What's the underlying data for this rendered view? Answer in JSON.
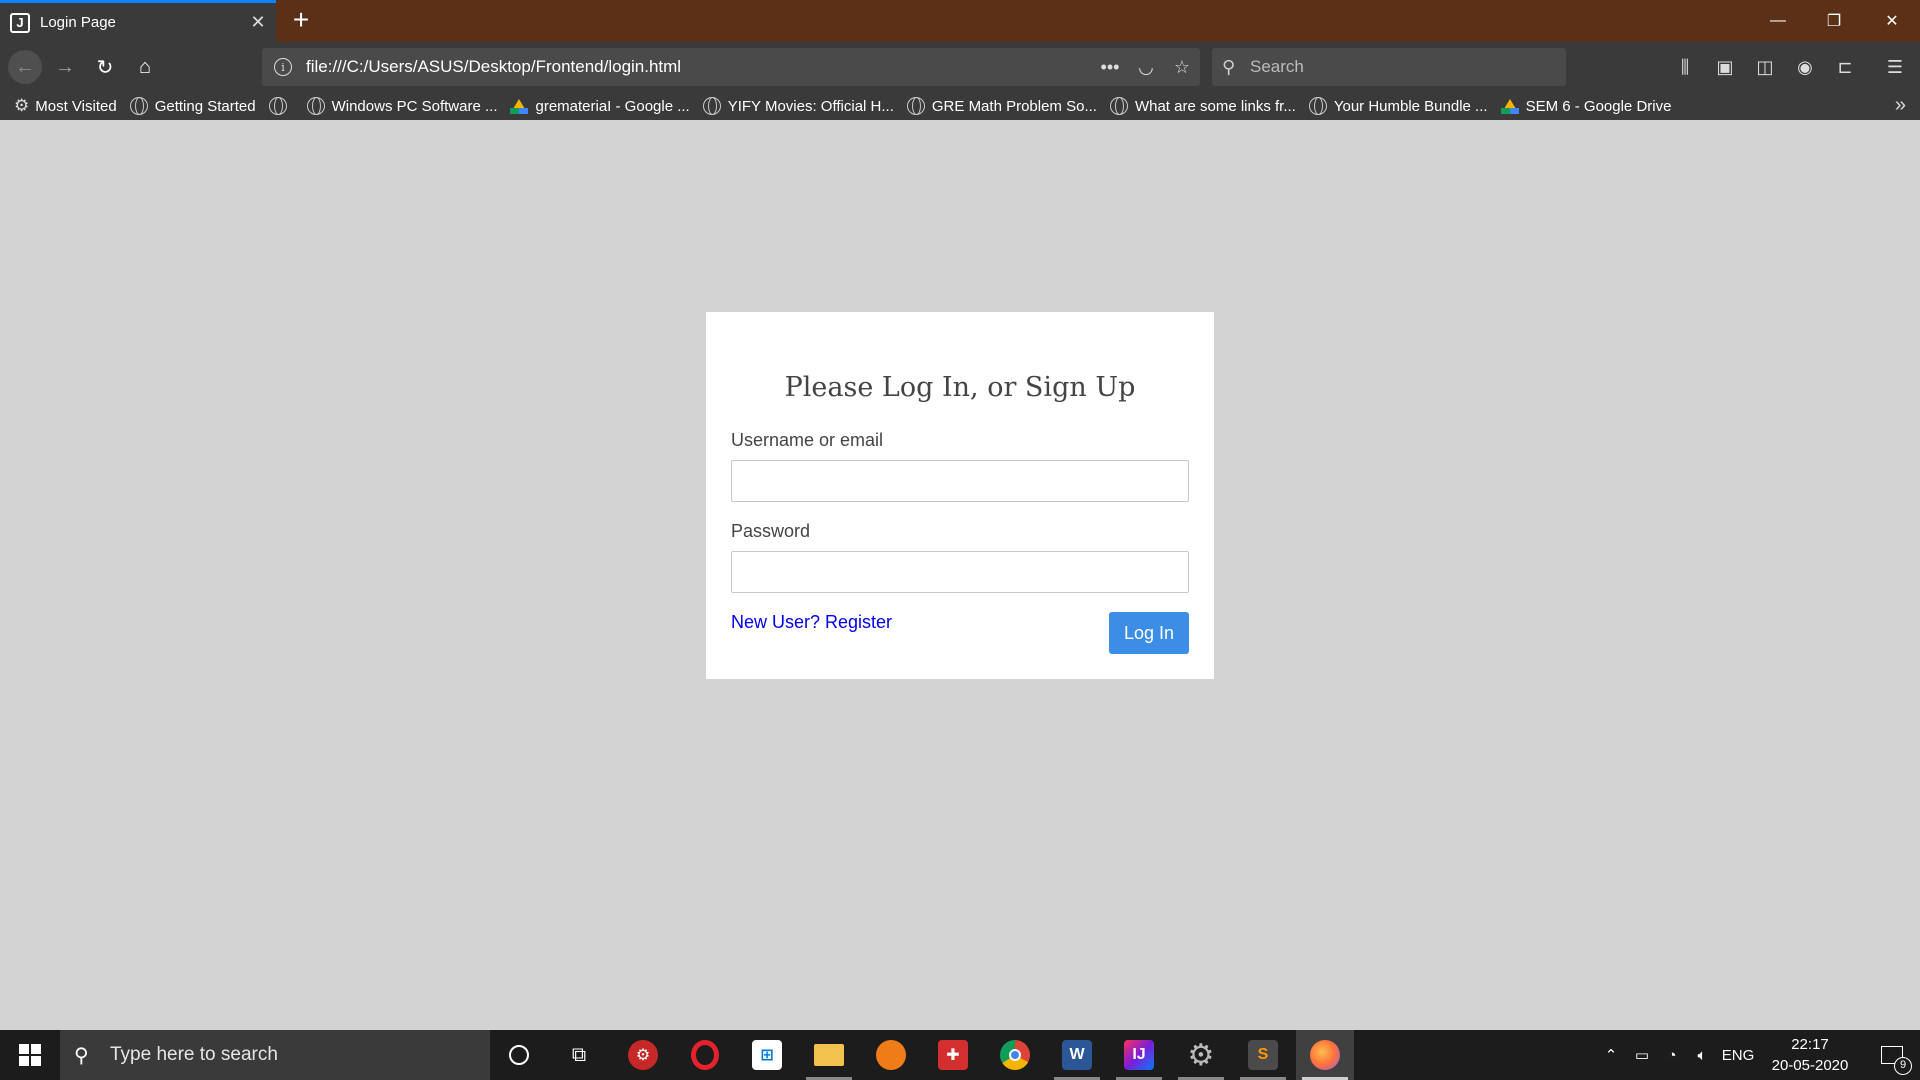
{
  "browser": {
    "tab": {
      "title": "Login Page",
      "favicon_letter": "J"
    },
    "url": "file:///C:/Users/ASUS/Desktop/Frontend/login.html",
    "search_placeholder": "Search",
    "bookmarks": [
      {
        "label": "Most Visited",
        "icon": "gear-icon"
      },
      {
        "label": "Getting Started",
        "icon": "globe-icon"
      },
      {
        "label": "",
        "icon": "globe-icon"
      },
      {
        "label": "Windows PC Software ...",
        "icon": "globe-icon"
      },
      {
        "label": "gremateriaI - Google ...",
        "icon": "google-drive-icon"
      },
      {
        "label": "YIFY Movies: Official H...",
        "icon": "globe-icon"
      },
      {
        "label": "GRE Math Problem So...",
        "icon": "globe-icon"
      },
      {
        "label": "What are some links fr...",
        "icon": "globe-icon"
      },
      {
        "label": "Your Humble Bundle ...",
        "icon": "globe-icon"
      },
      {
        "label": "SEM 6 - Google Drive",
        "icon": "google-drive-icon"
      }
    ]
  },
  "login": {
    "title": "Please Log In, or Sign Up",
    "username_label": "Username or email",
    "username_value": "",
    "password_label": "Password",
    "password_value": "",
    "register_link": "New User? Register",
    "login_button": "Log In"
  },
  "taskbar": {
    "search_placeholder": "Type here to search",
    "language": "ENG",
    "time": "22:17",
    "date": "20-05-2020",
    "notification_count": "9"
  },
  "colors": {
    "page_background": "#d3d3d3",
    "login_button": "#3b8de5",
    "link": "#0000ee",
    "tab_bar": "#5c3016"
  }
}
